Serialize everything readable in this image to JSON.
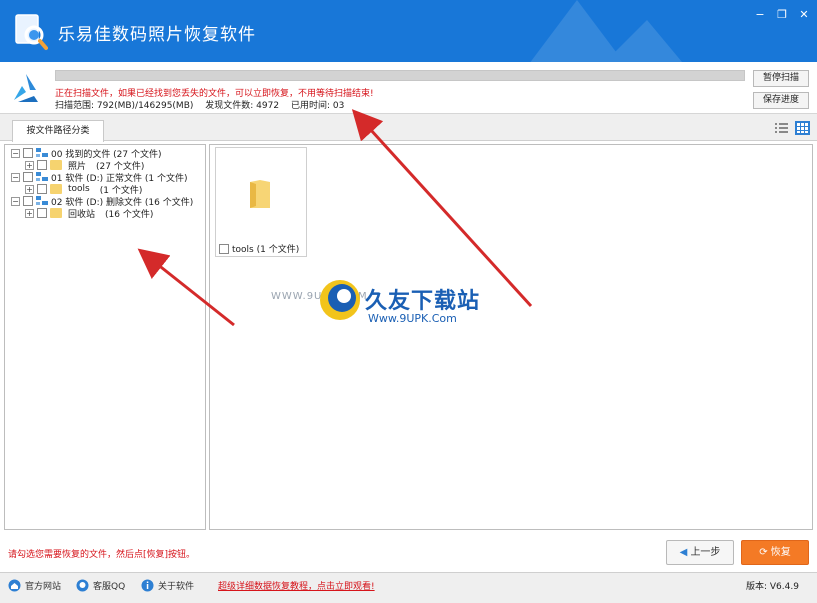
{
  "window": {
    "title": "乐易佳数码照片恢复软件"
  },
  "scan": {
    "progress_fraction": 1.0,
    "message": "正在扫描文件，如果已经找到您丢失的文件，可以立即恢复，不用等待扫描结束!",
    "range": "扫描范围: 792(MB)/146295(MB)",
    "found": "发现文件数: 4972",
    "elapsed": "已用时间: 03",
    "pause_label": "暂停扫描",
    "save_label": "保存进度"
  },
  "tabs": [
    {
      "label": "按文件路径分类"
    }
  ],
  "tree": {
    "items": [
      {
        "label": "00 找到的文件 (27 个文件)"
      },
      {
        "label": "照片",
        "count": "(27 个文件)"
      },
      {
        "label": "01 软件 (D:) 正常文件 (1 个文件)"
      },
      {
        "label": "tools",
        "count": "(1 个文件)"
      },
      {
        "label": "02 软件 (D:) 删除文件 (16 个文件)"
      },
      {
        "label": "回收站",
        "count": "(16 个文件)"
      }
    ]
  },
  "files": [
    {
      "label": "tools (1 个文件)"
    }
  ],
  "watermark": {
    "name": "久友下载站",
    "url": "Www.9UPK.Com",
    "site": "WWW.9UPK.COM"
  },
  "footer": {
    "hint": "请勾选您需要恢复的文件，然后点[恢复]按钮。",
    "prev_label": "上一步",
    "recover_label": "恢复",
    "website_label": "官方网站",
    "qq_label": "客服QQ",
    "about_label": "关于软件",
    "tutorial_link": "超级详细数据恢复教程，点击立即观看!",
    "version": "版本: V6.4.9"
  },
  "colors": {
    "titlebar": "#1877d8",
    "warning_text": "#d6131a",
    "recover_button": "#f47a25",
    "annotation_arrow": "#d42a2a"
  }
}
